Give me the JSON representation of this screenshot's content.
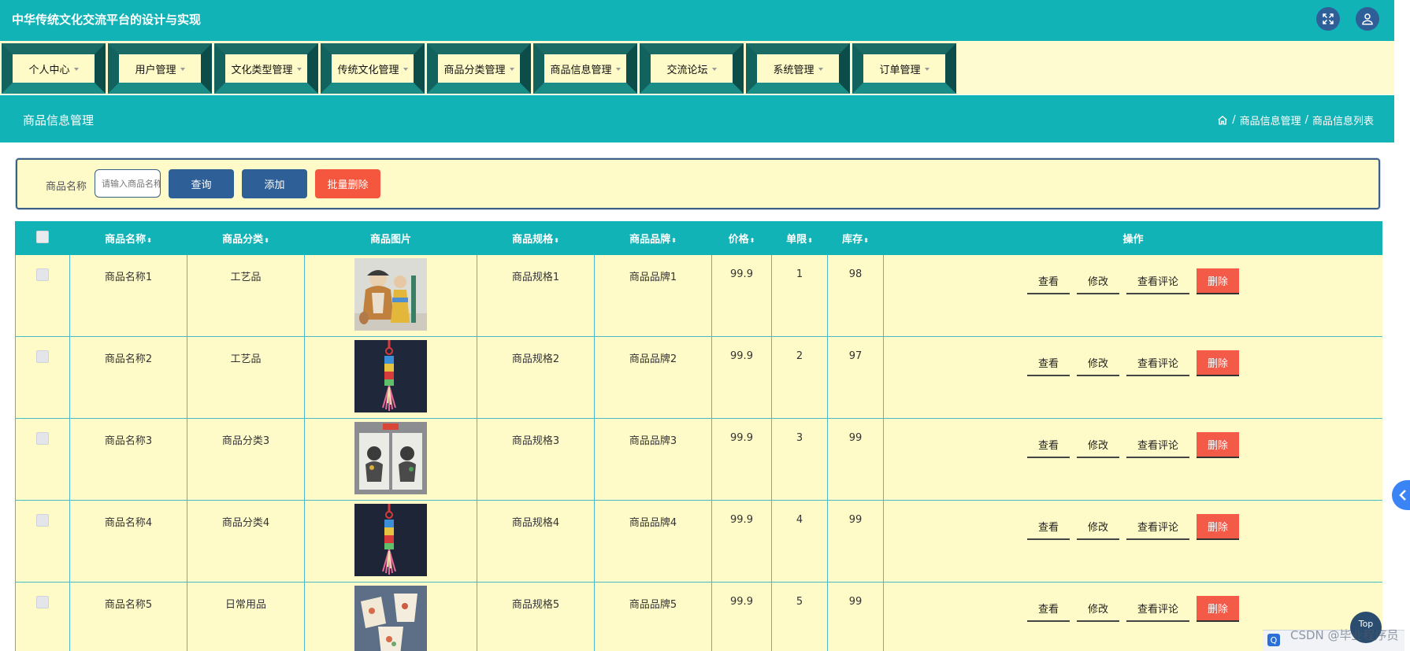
{
  "app": {
    "title": "中华传统文化交流平台的设计与实现"
  },
  "header": {
    "expand_icon": "fullscreen-icon",
    "user_icon": "user-icon"
  },
  "menu": [
    {
      "label": "个人中心"
    },
    {
      "label": "用户管理"
    },
    {
      "label": "文化类型管理"
    },
    {
      "label": "传统文化管理"
    },
    {
      "label": "商品分类管理"
    },
    {
      "label": "商品信息管理"
    },
    {
      "label": "交流论坛"
    },
    {
      "label": "系统管理"
    },
    {
      "label": "订单管理"
    }
  ],
  "section": {
    "title": "商品信息管理",
    "breadcrumb": {
      "level1": "商品信息管理",
      "level2": "商品信息列表",
      "sep": "/"
    }
  },
  "search": {
    "label": "商品名称",
    "placeholder": "请输入商品名称",
    "query_label": "查询",
    "add_label": "添加",
    "batch_delete_label": "批量删除"
  },
  "table": {
    "headers": {
      "name": "商品名称",
      "category": "商品分类",
      "image": "商品图片",
      "spec": "商品规格",
      "brand": "商品品牌",
      "price": "价格",
      "limit": "单限",
      "stock": "库存",
      "actions": "操作"
    },
    "sort_glyph": "⬍",
    "rows": [
      {
        "name": "商品名称1",
        "category": "工艺品",
        "image": "clay-figurines",
        "spec": "商品规格1",
        "brand": "商品品牌1",
        "price": "99.9",
        "limit": "1",
        "stock": "98"
      },
      {
        "name": "商品名称2",
        "category": "工艺品",
        "image": "chinese-knot-tassel",
        "spec": "商品规格2",
        "brand": "商品品牌2",
        "price": "99.9",
        "limit": "2",
        "stock": "97"
      },
      {
        "name": "商品名称3",
        "category": "商品分类3",
        "image": "paper-cut-prints",
        "spec": "商品规格3",
        "brand": "商品品牌3",
        "price": "99.9",
        "limit": "3",
        "stock": "99"
      },
      {
        "name": "商品名称4",
        "category": "商品分类4",
        "image": "chinese-knot-tassel",
        "spec": "商品规格4",
        "brand": "商品品牌4",
        "price": "99.9",
        "limit": "4",
        "stock": "99"
      },
      {
        "name": "商品名称5",
        "category": "日常用品",
        "image": "porcelain-cups",
        "spec": "商品规格5",
        "brand": "商品品牌5",
        "price": "99.9",
        "limit": "5",
        "stock": "99"
      }
    ],
    "actions": {
      "view": "查看",
      "edit": "修改",
      "view_comments": "查看评论",
      "delete": "删除"
    }
  },
  "floating": {
    "top_label": "Top",
    "side_tab_icon": "chevron-left-icon"
  },
  "watermark": {
    "text": "CSDN @毕业程序员"
  },
  "colors": {
    "teal": "#12b3b6",
    "cream": "#fffbc8",
    "navy_button": "#2e5f96",
    "red_button": "#f4573e"
  }
}
